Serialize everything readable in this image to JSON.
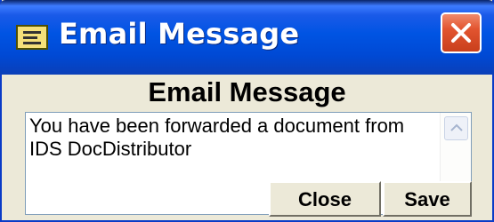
{
  "window": {
    "title": "Email Message",
    "close_symbol": "×"
  },
  "dialog": {
    "heading": "Email Message",
    "message": "You have been forwarded a document from IDS DocDistributor"
  },
  "buttons": {
    "close_label": "Close",
    "save_label": "Save"
  },
  "icons": {
    "app": "memo-icon",
    "window_close": "close-icon",
    "scroll_up": "arrow-up-icon",
    "scroll_down": "arrow-down-icon"
  },
  "colors": {
    "titlebar": "#0054e3",
    "window_bg": "#ece9d8",
    "close_button": "#e2542f",
    "field_border": "#7f9db9"
  }
}
